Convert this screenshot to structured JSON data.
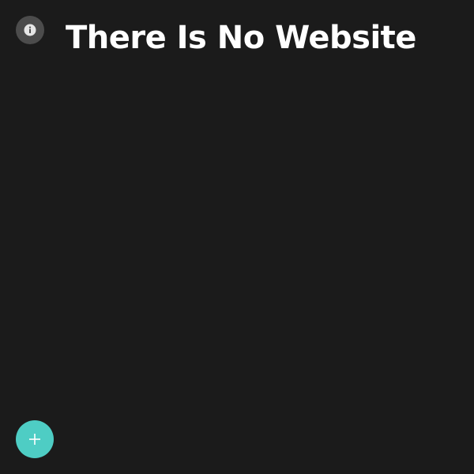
{
  "page": {
    "title": "There Is No Website"
  },
  "icons": {
    "info": "info-icon",
    "add": "plus-icon"
  },
  "colors": {
    "background": "#1b1b1b",
    "info_button": "#4c4c4c",
    "title_text": "#ffffff",
    "fab": "#4ecdc4"
  }
}
